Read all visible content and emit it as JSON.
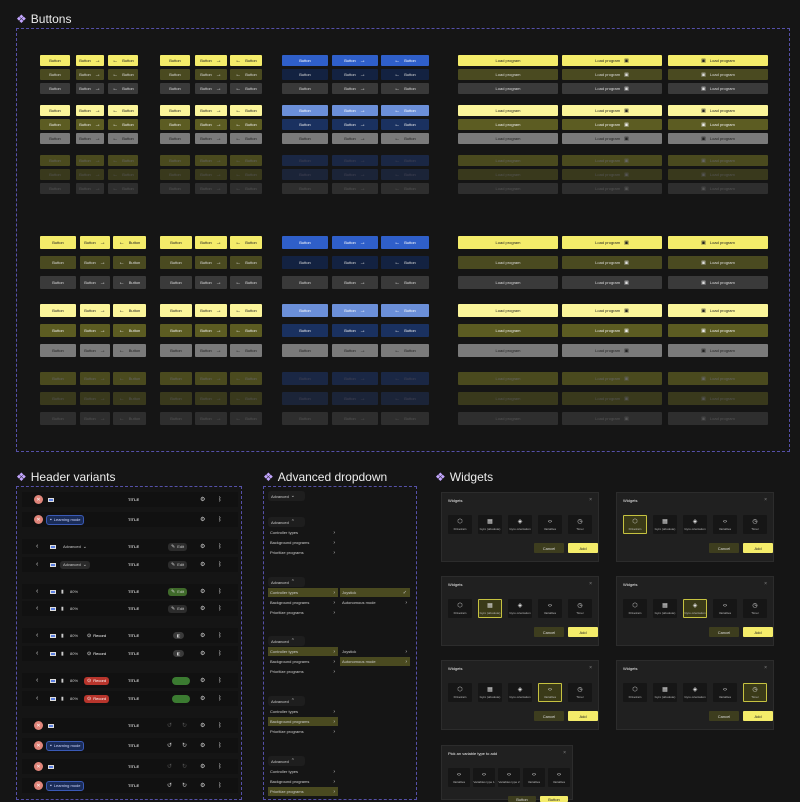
{
  "sections": {
    "buttons": "Buttons",
    "header": "Header variants",
    "dropdown": "Advanced dropdown",
    "widgets": "Widgets"
  },
  "colors": {
    "yellow": "#f1e85c",
    "olive": "#4d4d22",
    "gray": "#3a3a3a",
    "blue": "#2f5fc9",
    "navy": "#13213e",
    "accent": "#c3a6ff"
  },
  "labels": {
    "button": "Button",
    "load": "Load program"
  },
  "header": {
    "title": "TITLE",
    "learning": "Learning mode",
    "advanced": "Advanced",
    "edit": "Edit",
    "percent": "80%",
    "record": "Record"
  },
  "dropdown": {
    "advanced": "Advanced",
    "items": [
      "Controller types",
      "Background programs",
      "Prioritize programs"
    ],
    "sub1": [
      "Joystick",
      "Autonomous mode"
    ]
  },
  "widgets": {
    "title": "Widgets",
    "tiles": [
      "Drivetrain",
      "Gyro (absolute)",
      "Gyro orientation",
      "Variables",
      "Timer"
    ],
    "cancel": "Cancel",
    "add": "Add",
    "picker_title": "Pick an variable type to add",
    "picker_tiles": [
      "Variables",
      "Variables type 1",
      "Variables type 2",
      "Variables",
      "Variables"
    ],
    "picker_cancel": "Button",
    "picker_add": "Button"
  }
}
